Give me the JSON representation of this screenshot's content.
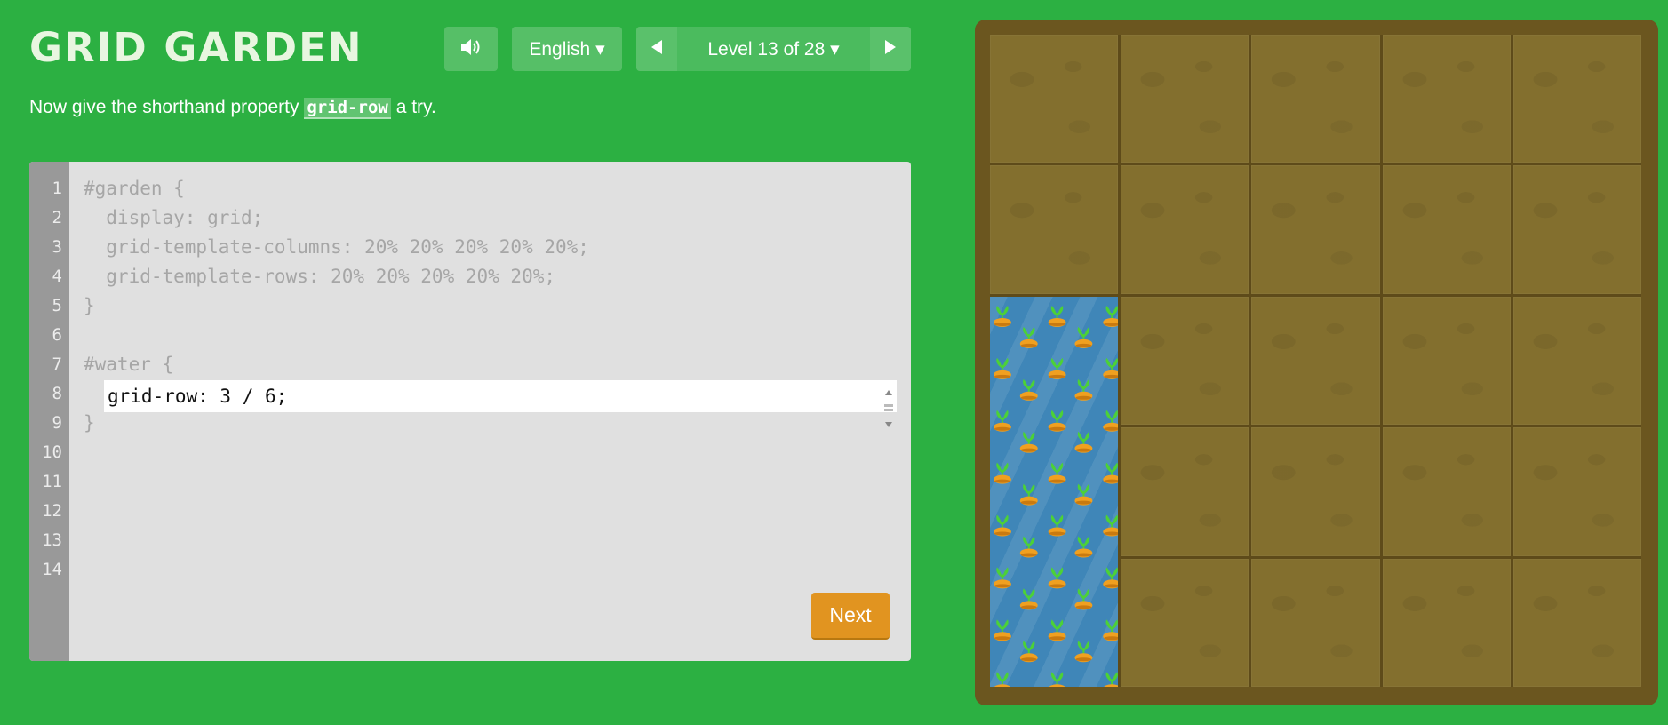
{
  "app": {
    "title": "GRID GARDEN"
  },
  "header": {
    "sound_icon": "speaker-icon",
    "language": "English ▾",
    "prev_icon": "triangle-left-icon",
    "level": "Level 13 of 28 ▾",
    "next_icon": "triangle-right-icon"
  },
  "instructions": {
    "before": "Now give the shorthand property ",
    "code": "grid-row",
    "after": " a try."
  },
  "editor": {
    "line_numbers": [
      "1",
      "2",
      "3",
      "4",
      "5",
      "6",
      "7",
      "8",
      "9",
      "10",
      "11",
      "12",
      "13",
      "14"
    ],
    "lines": {
      "l1": "#garden {",
      "l2": "  display: grid;",
      "l3": "  grid-template-columns: 20% 20% 20% 20% 20%;",
      "l4": "  grid-template-rows: 20% 20% 20% 20% 20%;",
      "l5": "}",
      "l7": "#water {",
      "l9": "}"
    },
    "input_value": "grid-row: 3 / 6;",
    "next_label": "Next"
  },
  "garden": {
    "columns": 5,
    "rows": 5,
    "water": {
      "row_start": 3,
      "row_end": 6,
      "column_start": 1,
      "column_end": 2
    },
    "colors": {
      "background": "#2cb042",
      "soil": "#836f2e",
      "frame": "#6b561f",
      "water": "#3f86b8",
      "carrot": "#f0a020",
      "leaf": "#4cd137",
      "next_button": "#e19420"
    }
  }
}
